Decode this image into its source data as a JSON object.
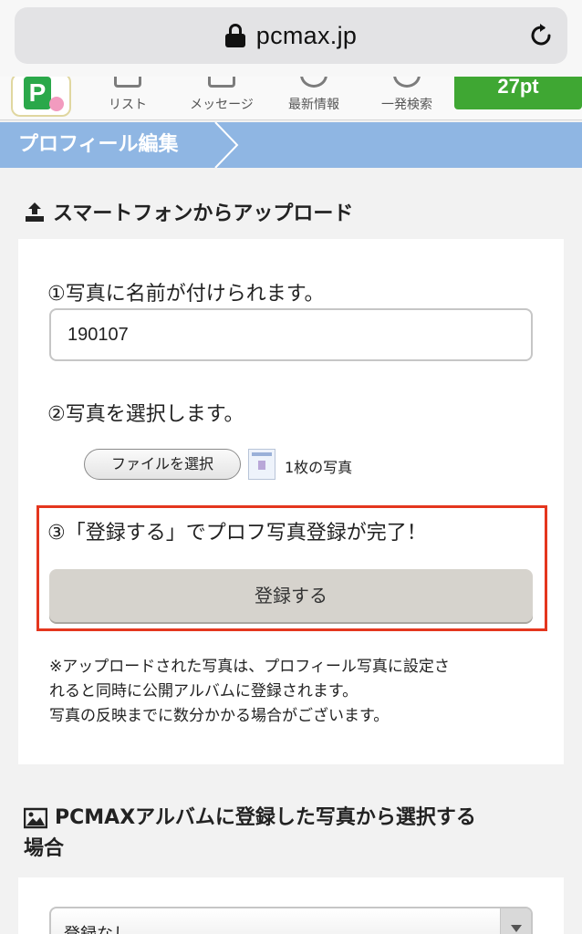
{
  "browser": {
    "url": "pcmax.jp"
  },
  "nav": {
    "items": [
      {
        "label": "リスト"
      },
      {
        "label": "メッセージ"
      },
      {
        "label": "最新情報"
      },
      {
        "label": "一発検索"
      }
    ],
    "points": "27pt"
  },
  "header": {
    "title": "プロフィール編集"
  },
  "upload": {
    "title": "スマートフォンからアップロード",
    "step1": "①写真に名前が付けられます。",
    "name_value": "190107",
    "step2": "②写真を選択します。",
    "file_button": "ファイルを選択",
    "file_count": "1枚の写真",
    "step3": "③「登録する」でプロフ写真登録が完了！",
    "submit": "登録する",
    "note_lines": [
      "※アップロードされた写真は、プロフィール写真に設定さ",
      "れると同時に公開アルバムに登録されます。",
      "写真の反映までに数分かかる場合がございます。"
    ]
  },
  "album": {
    "title_line1": "PCMAXアルバムに登録した写真から選択する",
    "title_line2": "場合",
    "select_value": "登録なし"
  },
  "colors": {
    "band": "#8fb6e3",
    "highlight": "#e4361e",
    "points_bg": "#3fa733"
  }
}
